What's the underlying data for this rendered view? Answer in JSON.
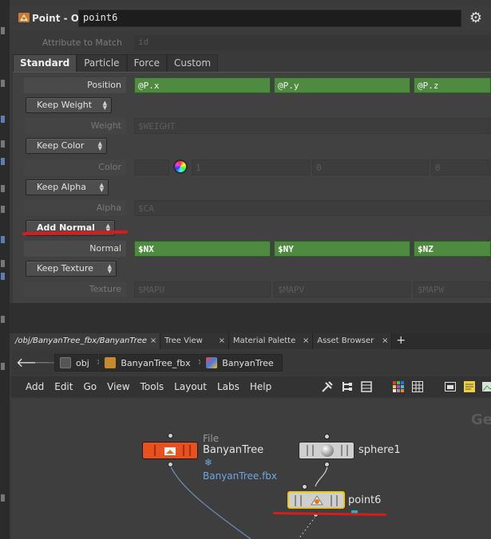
{
  "header": {
    "op_type": "Point - Old",
    "node_name": "point6",
    "gear_icon": "gear-icon"
  },
  "ghost": {
    "label": "Attribute to Match",
    "value": "id"
  },
  "tabs": [
    {
      "label": "Standard",
      "active": true
    },
    {
      "label": "Particle",
      "active": false
    },
    {
      "label": "Force",
      "active": false
    },
    {
      "label": "Custom",
      "active": false
    }
  ],
  "params": {
    "position": {
      "label": "Position",
      "x": "@P.x",
      "y": "@P.y",
      "z": "@P.z"
    },
    "keep_weight": "Keep Weight",
    "weight": {
      "label": "Weight",
      "value": "$WEIGHT"
    },
    "keep_color": "Keep Color",
    "color": {
      "label": "Color",
      "r": "1",
      "g": "0",
      "b": "0"
    },
    "keep_alpha": "Keep Alpha",
    "alpha": {
      "label": "Alpha",
      "value": "$CA"
    },
    "add_normal": "Add Normal",
    "normal": {
      "label": "Normal",
      "x": "$NX",
      "y": "$NY",
      "z": "$NZ"
    },
    "keep_texture": "Keep Texture",
    "texture": {
      "label": "Texture",
      "u": "$MAPU",
      "v": "$MAPV",
      "w": "$MAPW"
    }
  },
  "pane_tabs": [
    {
      "label": "/obj/BanyanTree_fbx/BanyanTree",
      "close": "×",
      "active": true
    },
    {
      "label": "Tree View",
      "close": "×",
      "active": false
    },
    {
      "label": "Material Palette",
      "close": "×",
      "active": false
    },
    {
      "label": "Asset Browser",
      "close": "×",
      "active": false
    }
  ],
  "pane_plus": "+",
  "path": {
    "obj": "obj",
    "fbx": "BanyanTree_fbx",
    "tree": "BanyanTree"
  },
  "menu": [
    "Add",
    "Edit",
    "Go",
    "View",
    "Tools",
    "Layout",
    "Labs",
    "Help"
  ],
  "network": {
    "watermark": "Ge",
    "file_node": {
      "type": "File",
      "name": "BanyanTree",
      "file": "BanyanTree.fbx"
    },
    "sphere_node": {
      "name": "sphere1"
    },
    "point_node": {
      "name": "point6"
    }
  },
  "colors": {
    "green_field": "#4e8b40",
    "annotation_red": "#d81c1c",
    "selected_node": "#f0c419",
    "file_node": "#e8501e"
  }
}
